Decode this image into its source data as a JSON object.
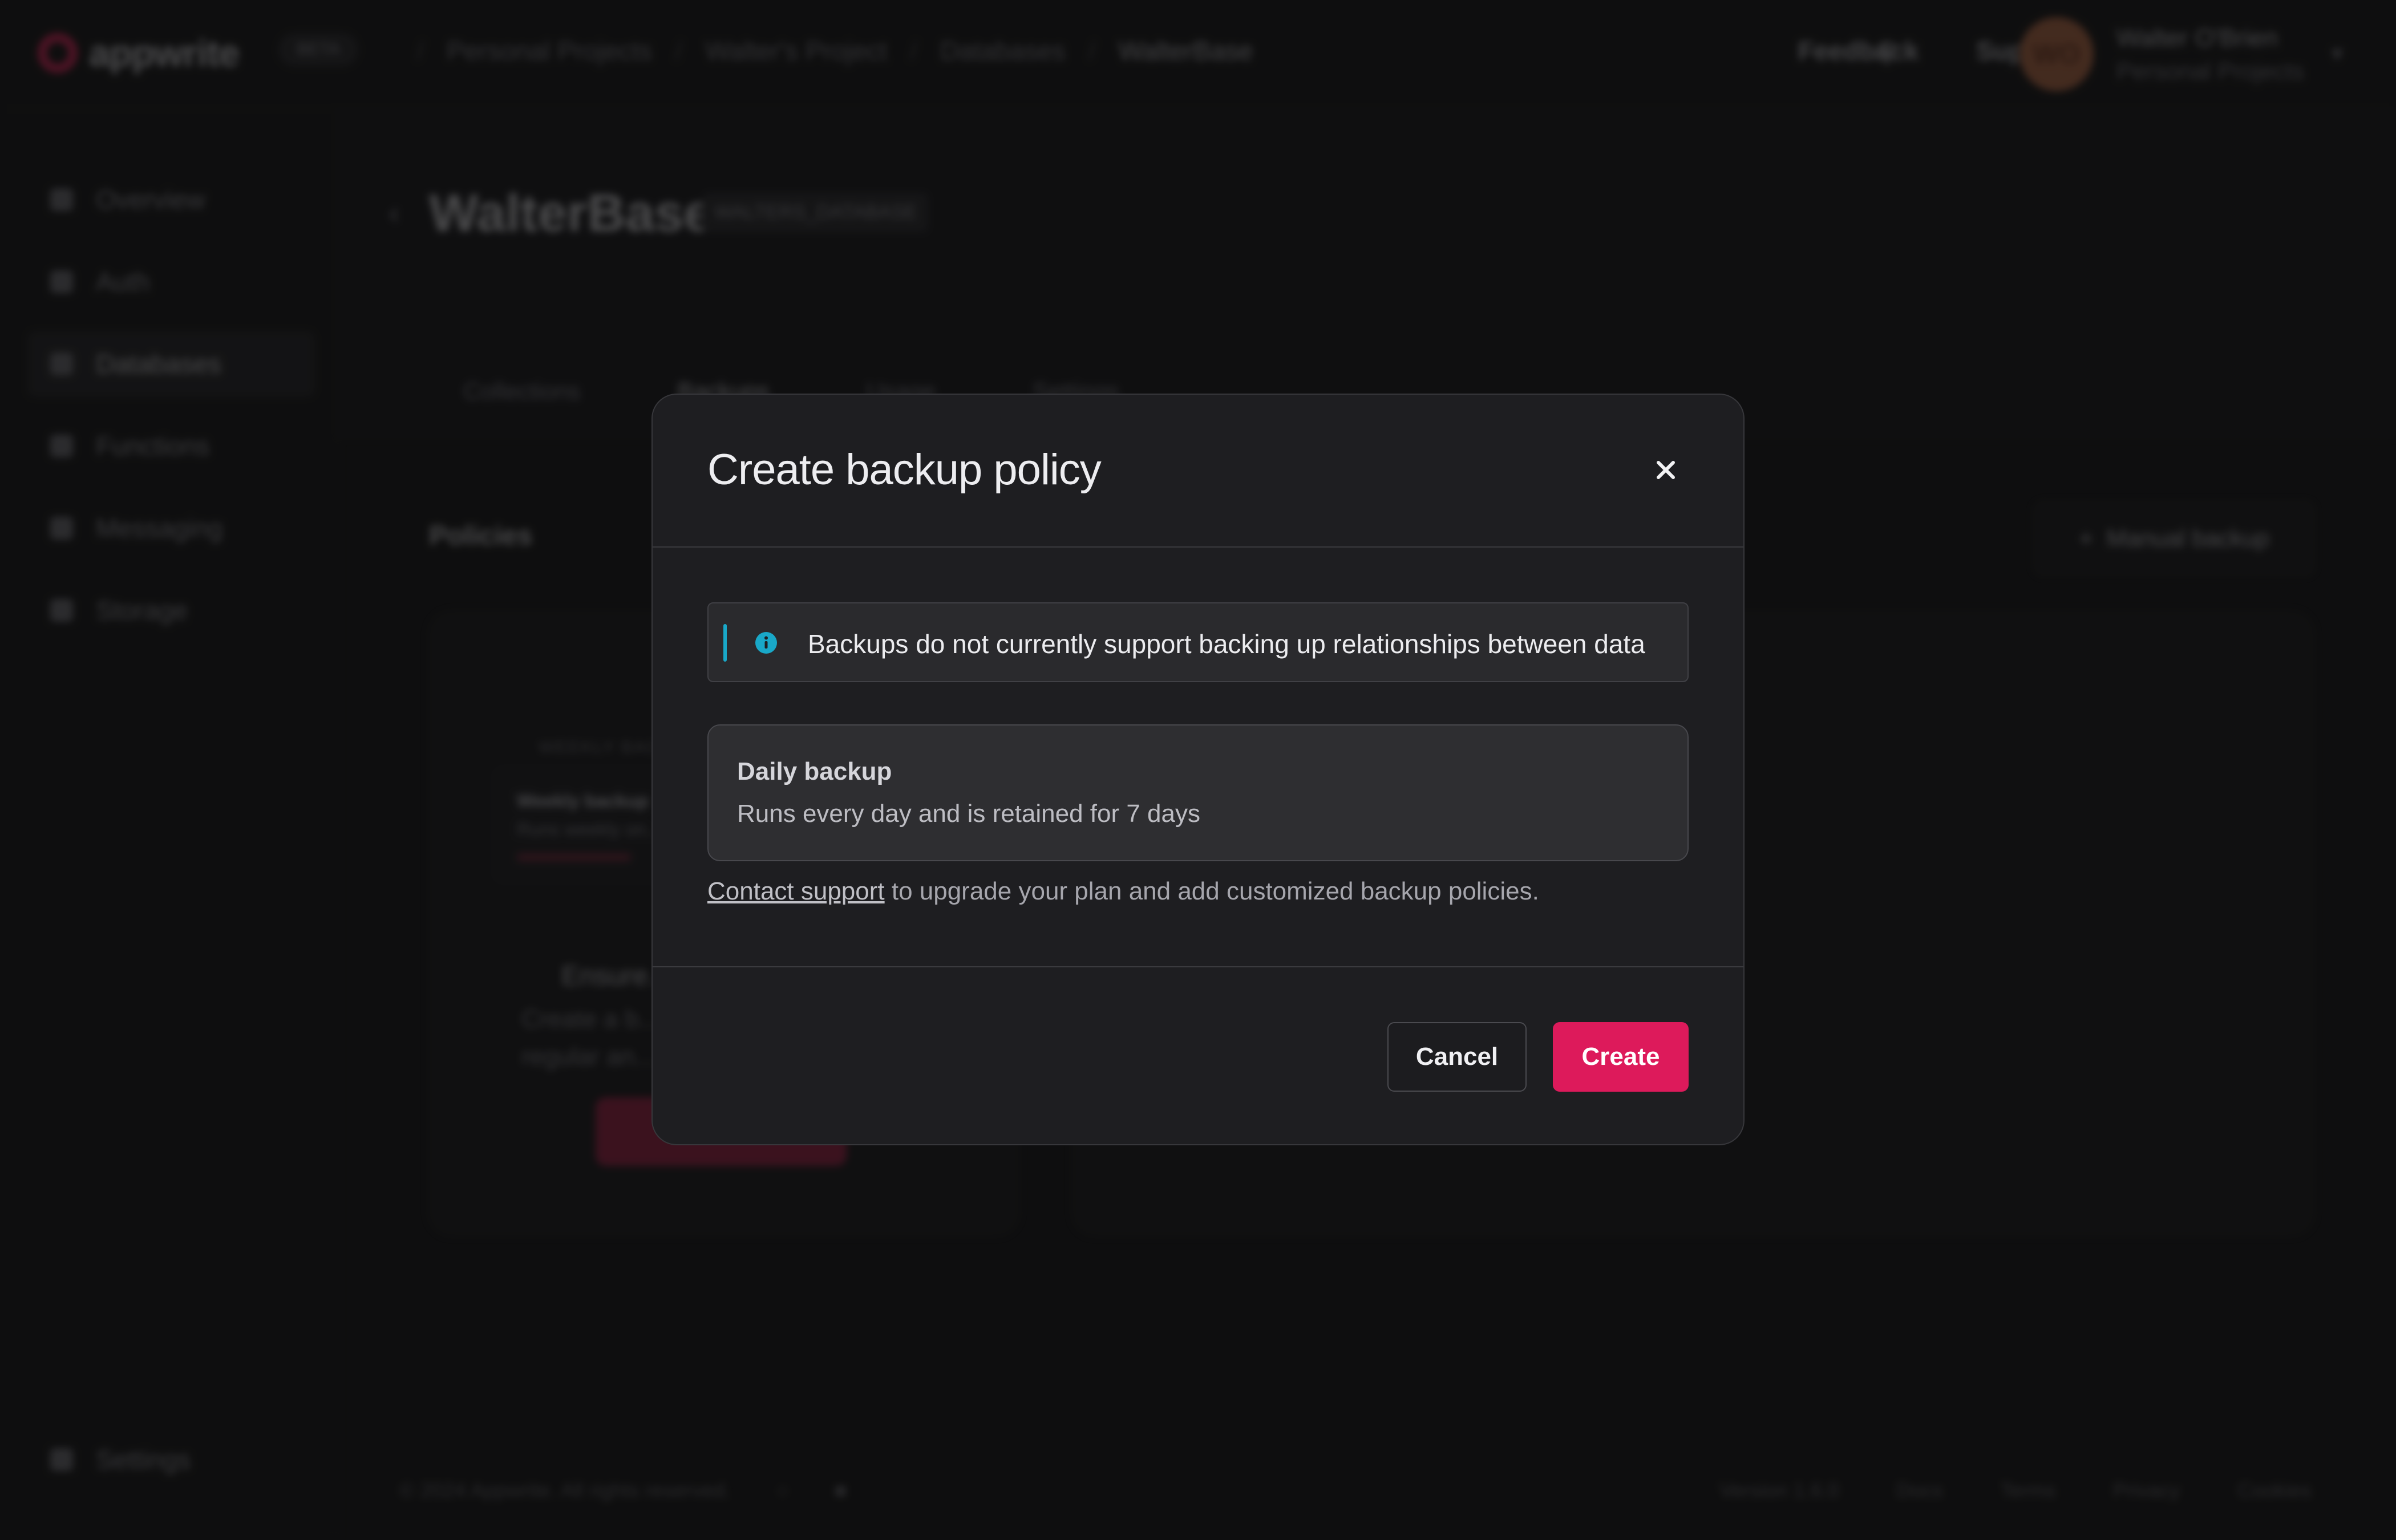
{
  "app": {
    "logo_text": "appwrite",
    "beta_badge": "BETA",
    "breadcrumbs": [
      "Personal Projects",
      "Walter's Project",
      "Databases",
      "WalterBase"
    ],
    "header_links": {
      "feedback": "Feedback",
      "support": "Support"
    },
    "user": {
      "initials": "WO",
      "name": "Walter O'Brien",
      "org": "Personal Projects"
    },
    "sidebar": {
      "items": [
        "Overview",
        "Auth",
        "Databases",
        "Functions",
        "Messaging",
        "Storage"
      ],
      "settings": "Settings"
    },
    "page": {
      "title": "WalterBase",
      "id_badge": "WALTERS_DATABASE",
      "tabs": [
        "Collections",
        "Backups",
        "Usage",
        "Settings"
      ],
      "section_title": "Policies",
      "manual_backup": "Manual backup",
      "mini_tag": "WEEKLY BACKUP",
      "mini_title": "Weekly backup",
      "mini_sub": "Runs weekly on...",
      "empty_heading": "Ensure...",
      "empty_line1": "Create a b...",
      "empty_line2": "regular an..."
    },
    "footer": {
      "copyright": "© 2024 Appwrite. All rights reserved.",
      "version": "Version 1.6.0",
      "links": [
        "Docs",
        "Terms",
        "Privacy",
        "Cookies"
      ]
    }
  },
  "modal": {
    "title": "Create backup policy",
    "alert_text": "Backups do not currently support backing up relationships between data",
    "policy": {
      "title": "Daily backup",
      "description": "Runs every day and is retained for 7 days"
    },
    "note_link": "Contact support",
    "note_text": " to upgrade your plan and add customized backup policies.",
    "cancel_label": "Cancel",
    "create_label": "Create"
  },
  "colors": {
    "accent": "#dd1a5b",
    "info": "#19a8c8",
    "surface": "#1e1e21"
  },
  "icons": {
    "close": "close-icon",
    "info": "info-icon",
    "search": "search-icon"
  }
}
